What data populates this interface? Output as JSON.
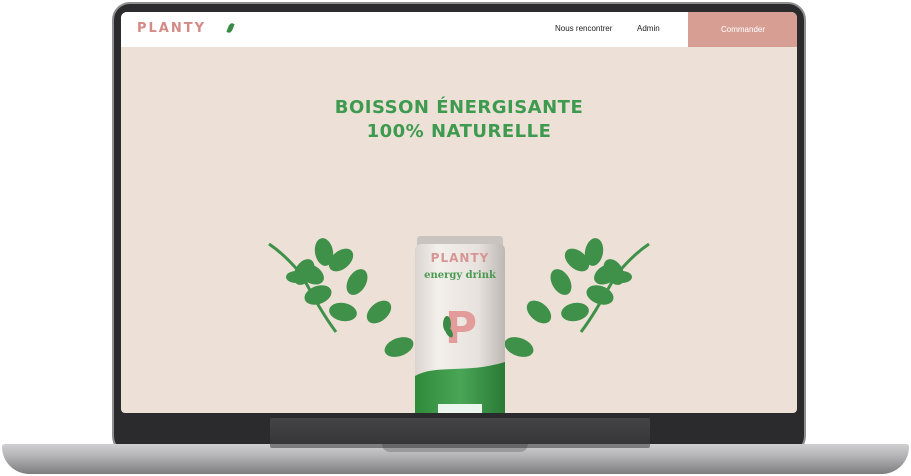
{
  "nav": {
    "logo": "PLANTY",
    "links": [
      "Nous rencontrer",
      "Admin"
    ],
    "cta": "Commander"
  },
  "hero": {
    "title_line1": "BOISSON ÉNERGISANTE",
    "title_line2": "100% NATURELLE"
  },
  "product": {
    "can_brand": "PLANTY",
    "can_subtitle": "energy drink",
    "can_letter": "P"
  },
  "colors": {
    "brand_pink": "#d48a85",
    "cta_bg": "#d79f94",
    "green": "#3d9a4f",
    "leaf_green": "#3a8a45",
    "background": "#ede1d7"
  }
}
